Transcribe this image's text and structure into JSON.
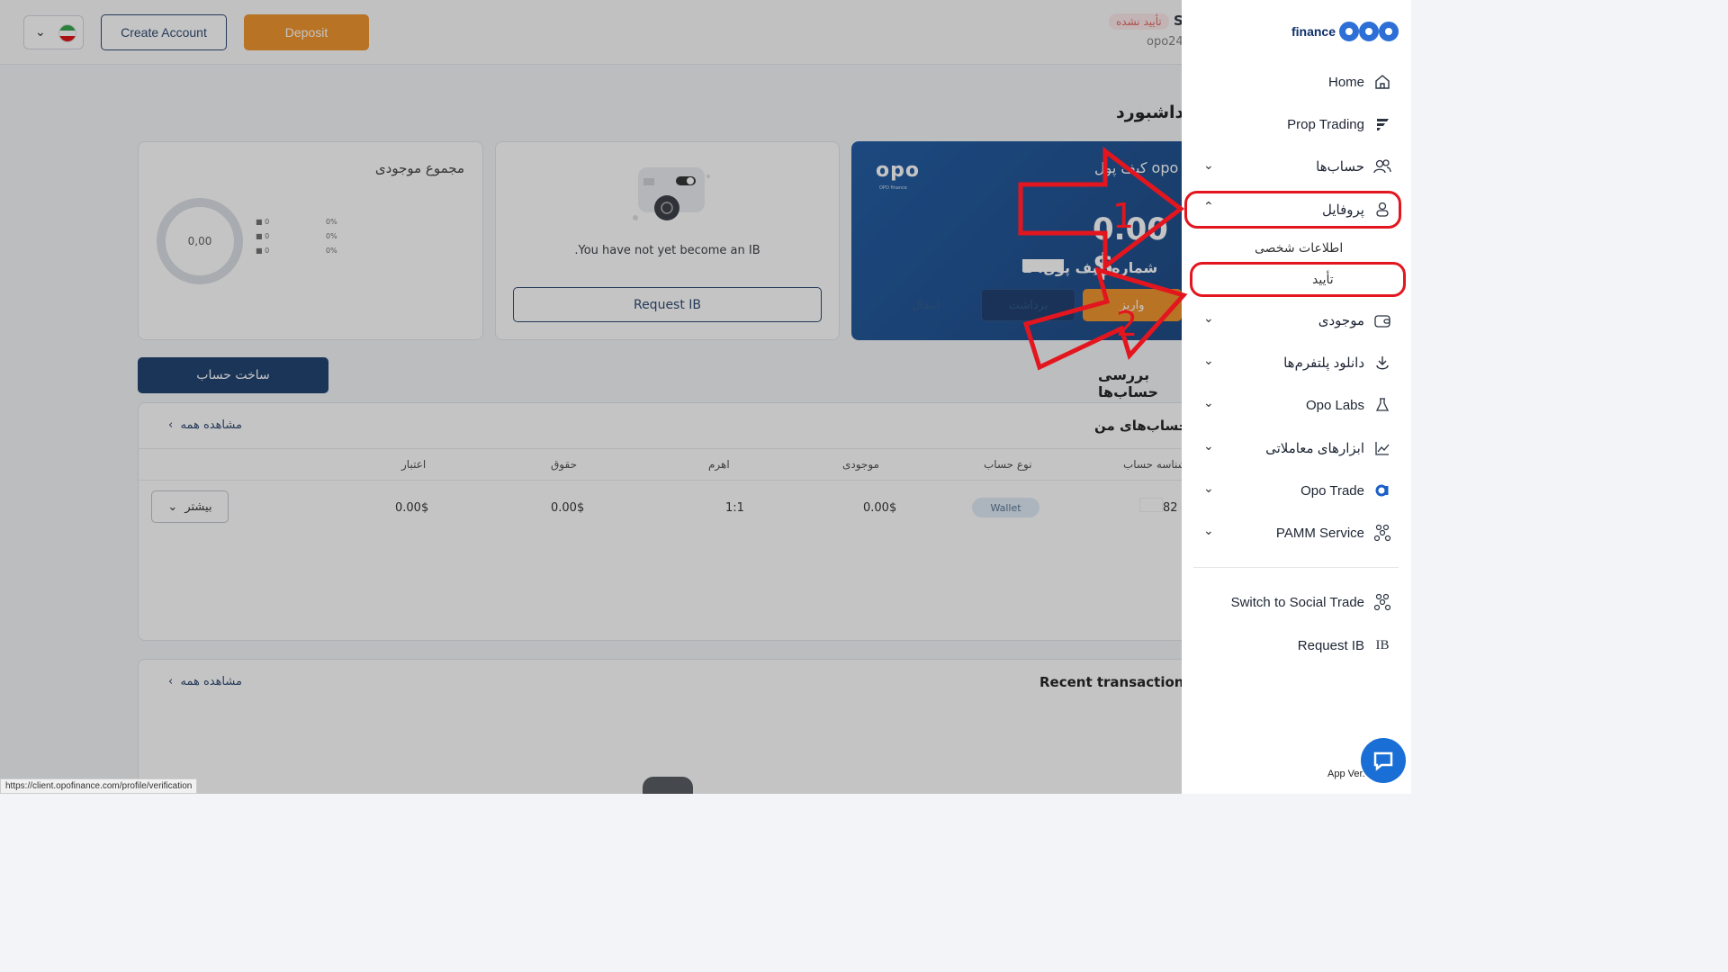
{
  "topbar": {
    "create_account": "Create Account",
    "deposit": "Deposit",
    "status_badge": "تأیید نشده",
    "user_initial": "S",
    "user_id": "opo24"
  },
  "dashboard": {
    "title": "داشبورد",
    "wallet": {
      "logo": "opo",
      "logo_sub": "OPO finance",
      "title": "کیف پول opo",
      "balance": "0.00 $",
      "number_label": "شماره کیف پول: 2",
      "btn_deposit": "واریز",
      "btn_withdraw": "برداشت",
      "btn_transfer": "انتقال"
    },
    "ib": {
      "message": ".You have not yet become an IB",
      "request_button": "Request IB"
    },
    "total": {
      "title": "مجموع موجودی",
      "donut_value": "0,00",
      "legend": [
        {
          "value": "0",
          "pct": "0%"
        },
        {
          "value": "0",
          "pct": "0%"
        },
        {
          "value": "0",
          "pct": "0%"
        }
      ]
    },
    "accounts_section_title": "بررسی حساب‌ها",
    "make_account": "ساخت حساب",
    "my_accounts": {
      "title": "حساب‌های من",
      "see_all": "مشاهده همه",
      "headers": [
        "شناسه حساب",
        "نوع حساب",
        "موجودی",
        "اهرم",
        "حقوق",
        "اعتبار"
      ],
      "row": {
        "id": "82",
        "type": "Wallet",
        "balance": "0.00$",
        "leverage": "1:1",
        "equity": "0.00$",
        "credit": "0.00$",
        "more": "بیشتر"
      }
    },
    "recent": {
      "title": "Recent transactions",
      "see_all": "مشاهده همه"
    }
  },
  "statusbar_url": "https://client.opofinance.com/profile/verification",
  "sidebar": {
    "brand": "finance",
    "items": [
      {
        "label": "Home"
      },
      {
        "label": "Prop Trading"
      },
      {
        "label": "حساب‌ها"
      },
      {
        "label": "پروفایل"
      },
      {
        "label": "موجودی"
      },
      {
        "label": "دانلود پلتفرم‌ها"
      },
      {
        "label": "Opo Labs"
      },
      {
        "label": "ابزارهای معاملاتی"
      },
      {
        "label": "Opo Trade"
      },
      {
        "label": "PAMM Service"
      }
    ],
    "profile_sub": [
      "اطلاعات شخصی",
      "تأیید"
    ],
    "switch_social": "Switch to Social Trade",
    "request_ib": "Request IB",
    "app_version": "App Ver."
  },
  "annotations": {
    "arrow1": "1",
    "arrow2": "2",
    "color": "#e3161f"
  }
}
